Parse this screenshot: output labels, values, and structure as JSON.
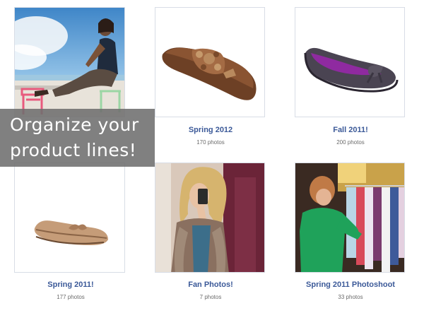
{
  "overlay": {
    "line1": "Organize your",
    "line2": "product lines!"
  },
  "albums": [
    {
      "title": "",
      "count": "",
      "image": "woman-beach-photo"
    },
    {
      "title": "Spring 2012",
      "count": "170 photos",
      "image": "beaded-sandal-photo"
    },
    {
      "title": "Fall 2011!",
      "count": "200 photos",
      "image": "purple-flat-photo"
    },
    {
      "title": "Spring 2011!",
      "count": "177 photos",
      "image": "tan-bow-flat-photo"
    },
    {
      "title": "Fan Photos!",
      "count": "7 photos",
      "image": "mirror-selfie-photo"
    },
    {
      "title": "Spring 2011 Photoshoot",
      "count": "33 photos",
      "image": "clothes-rack-photo"
    }
  ],
  "colors": {
    "link": "#3b5998",
    "overlay": "#6e6e6e"
  }
}
